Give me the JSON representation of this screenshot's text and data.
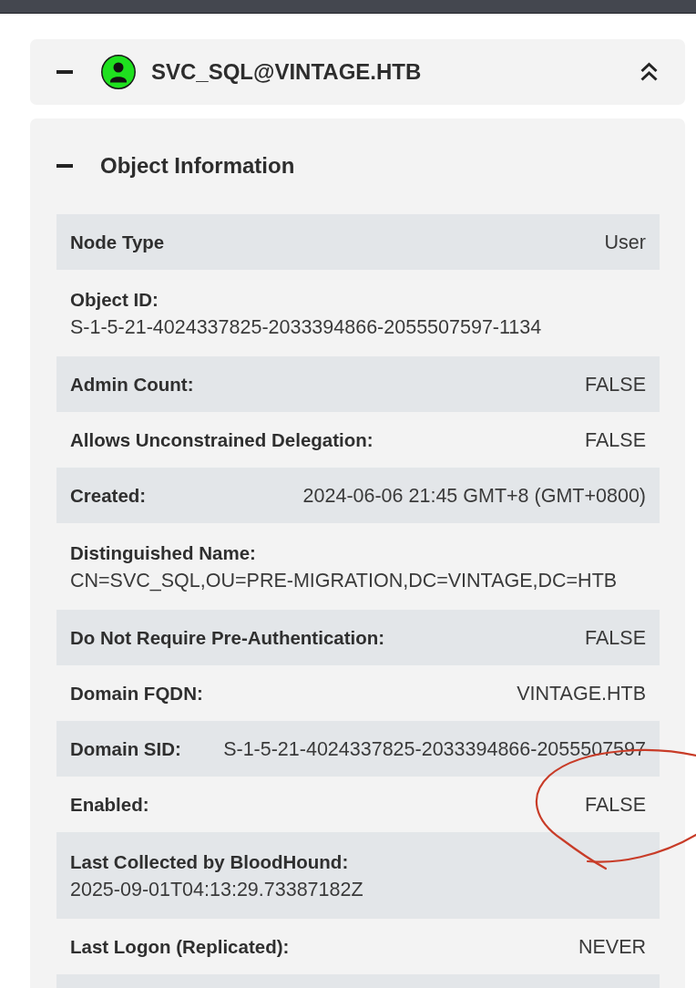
{
  "node": {
    "name": "SVC_SQL@VINTAGE.HTB",
    "expanded": true
  },
  "sections": [
    {
      "title": "Object Information",
      "expanded": true,
      "rows": [
        {
          "kind": "inline",
          "label": "Node Type",
          "value": "User",
          "circled": false
        },
        {
          "kind": "stacked",
          "label": "Object ID:",
          "value": "S-1-5-21-4024337825-2033394866-2055507597-1134",
          "circled": false
        },
        {
          "kind": "inline",
          "label": "Admin Count:",
          "value": "FALSE",
          "circled": false
        },
        {
          "kind": "inline",
          "label": "Allows Unconstrained Delegation:",
          "value": "FALSE",
          "circled": false
        },
        {
          "kind": "inline",
          "label": "Created:",
          "value": "2024-06-06 21:45 GMT+8 (GMT+0800)",
          "circled": false
        },
        {
          "kind": "stacked",
          "label": "Distinguished Name:",
          "value": "CN=SVC_SQL,OU=PRE-MIGRATION,DC=VINTAGE,DC=HTB",
          "circled": false
        },
        {
          "kind": "inline",
          "label": "Do Not Require Pre-Authentication:",
          "value": "FALSE",
          "circled": false
        },
        {
          "kind": "inline",
          "label": "Domain FQDN:",
          "value": "VINTAGE.HTB",
          "circled": false
        },
        {
          "kind": "inline",
          "label": "Domain SID:",
          "value": "S-1-5-21-4024337825-2033394866-2055507597",
          "circled": false
        },
        {
          "kind": "inline",
          "label": "Enabled:",
          "value": "FALSE",
          "circled": true
        },
        {
          "kind": "stacked",
          "label": "Last Collected by BloodHound:",
          "value": "2025-09-01T04:13:29.73387182Z",
          "circled": false
        },
        {
          "kind": "inline",
          "label": "Last Logon (Replicated):",
          "value": "NEVER",
          "circled": false
        }
      ]
    }
  ]
}
